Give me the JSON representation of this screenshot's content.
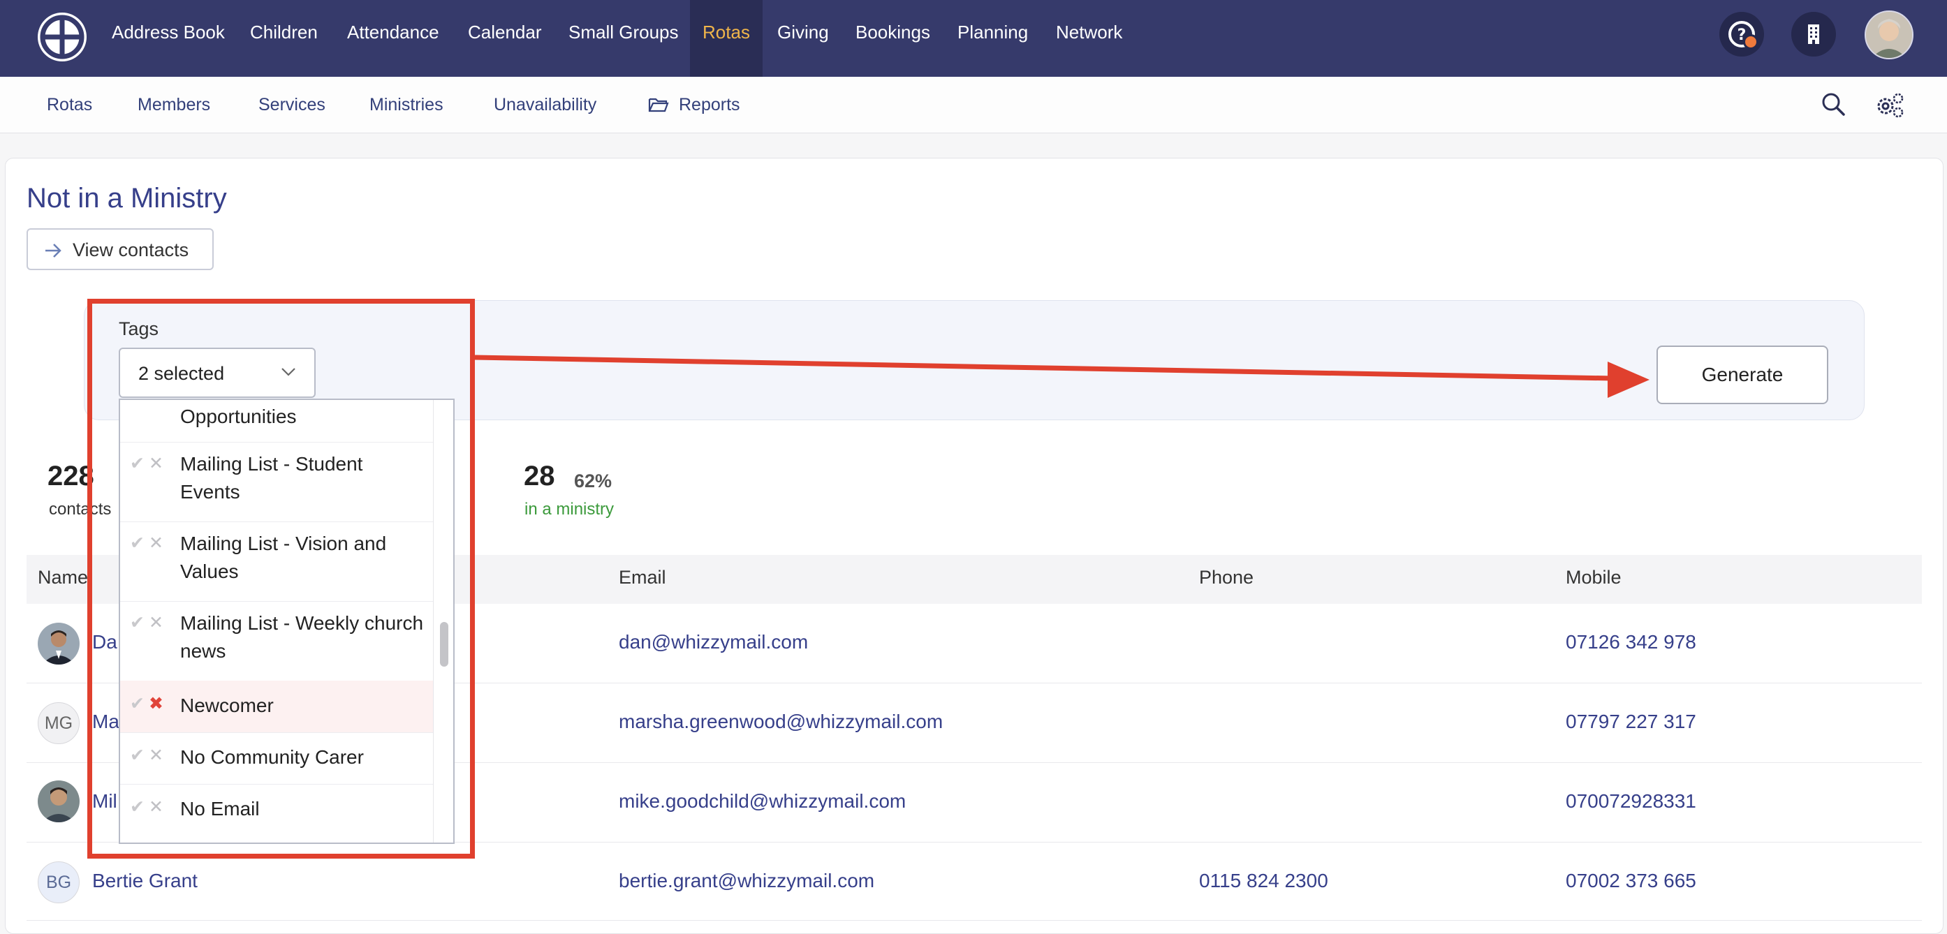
{
  "top_nav": {
    "items": [
      "Address Book",
      "Children",
      "Attendance",
      "Calendar",
      "Small Groups",
      "Rotas",
      "Giving",
      "Bookings",
      "Planning",
      "Network"
    ],
    "active": "Rotas",
    "icons": [
      "help-icon",
      "building-icon",
      "user-avatar"
    ],
    "accent_color": "#f0b54a",
    "bg_color": "#363a6b"
  },
  "sub_nav": {
    "items": [
      "Rotas",
      "Members",
      "Services",
      "Ministries",
      "Unavailability",
      "Reports"
    ],
    "icons": [
      "search-icon",
      "settings-icon"
    ]
  },
  "page": {
    "title": "Not in a Ministry",
    "view_contacts": "View contacts"
  },
  "filter": {
    "tags_label": "Tags",
    "tags_value": "2 selected",
    "generate": "Generate",
    "dropdown": [
      {
        "label": "Opportunities",
        "state": "partial"
      },
      {
        "label": "Mailing List - Student Events",
        "state": "none"
      },
      {
        "label": "Mailing List - Vision and Values",
        "state": "none"
      },
      {
        "label": "Mailing List - Weekly church news",
        "state": "none"
      },
      {
        "label": "Newcomer",
        "state": "excluded"
      },
      {
        "label": "No Community Carer",
        "state": "none"
      },
      {
        "label": "No Email",
        "state": "none"
      }
    ]
  },
  "stats": {
    "contacts_num": "228",
    "contacts_label": "contacts",
    "ministry_num": "28",
    "ministry_pct": "62%",
    "ministry_label": "in a ministry"
  },
  "table": {
    "headers": [
      "Name",
      "Email",
      "Phone",
      "Mobile"
    ],
    "rows": [
      {
        "name": "Da",
        "avatar": "photo",
        "email": "dan@whizzymail.com",
        "phone": "",
        "mobile": "07126 342 978"
      },
      {
        "name": "Ma",
        "avatar": "MG",
        "email": "marsha.greenwood@whizzymail.com",
        "phone": "",
        "mobile": "07797 227 317"
      },
      {
        "name": "Mil",
        "avatar": "photo",
        "email": "mike.goodchild@whizzymail.com",
        "phone": "",
        "mobile": "070072928331"
      },
      {
        "name": "Bertie Grant",
        "avatar": "BG",
        "email": "bertie.grant@whizzymail.com",
        "phone": "0115 824 2300",
        "mobile": "07002 373 665"
      }
    ]
  },
  "annotation_color": "#e0402e"
}
